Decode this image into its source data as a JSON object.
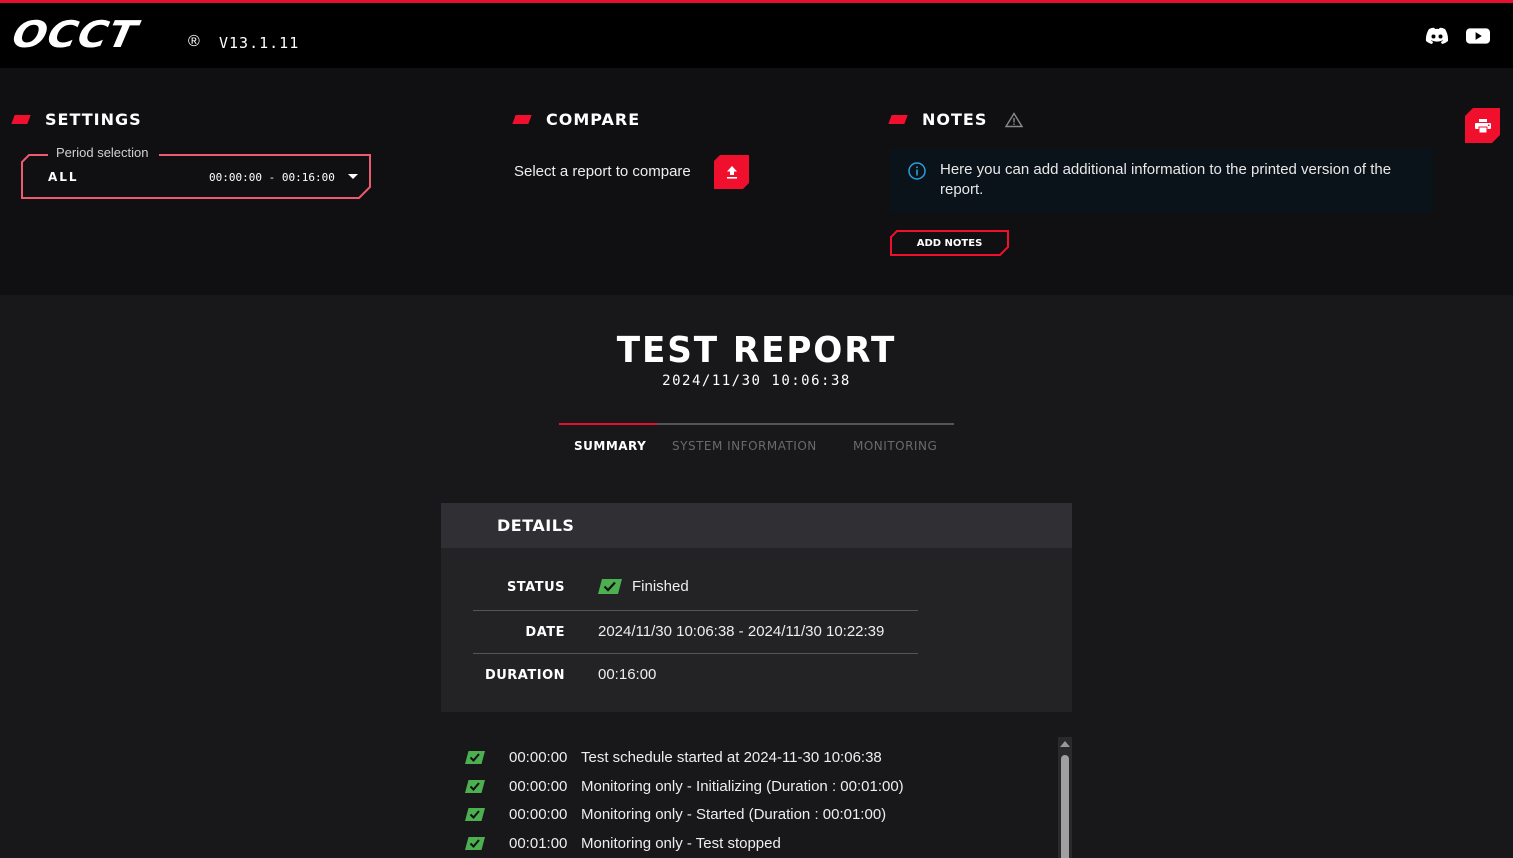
{
  "app": {
    "logo": "OCCT",
    "registered": "®",
    "version": "V13.1.11",
    "accent_color": "#f0102e"
  },
  "topbar_icons": [
    {
      "name": "discord-icon"
    },
    {
      "name": "youtube-icon"
    }
  ],
  "settings": {
    "title": "SETTINGS",
    "period_label": "Period selection",
    "period_value": "ALL",
    "period_range": "00:00:00 - 00:16:00"
  },
  "compare": {
    "title": "COMPARE",
    "prompt": "Select a report to compare"
  },
  "notes": {
    "title": "NOTES",
    "info_text": "Here you can add additional information to the printed version of the report.",
    "add_button": "ADD NOTES"
  },
  "report": {
    "title": "TEST REPORT",
    "date": "2024/11/30 10:06:38",
    "tabs": [
      {
        "label": "SUMMARY",
        "active": true
      },
      {
        "label": "SYSTEM INFORMATION",
        "active": false
      },
      {
        "label": "MONITORING",
        "active": false
      }
    ]
  },
  "details": {
    "title": "DETAILS",
    "rows": [
      {
        "label": "STATUS",
        "value": "Finished"
      },
      {
        "label": "DATE",
        "value": "2024/11/30 10:06:38 - 2024/11/30 10:22:39"
      },
      {
        "label": "DURATION",
        "value": "00:16:00"
      }
    ],
    "status_color": "#4caf50"
  },
  "log": [
    {
      "time": "00:00:00",
      "message": "Test schedule started at 2024-11-30 10:06:38"
    },
    {
      "time": "00:00:00",
      "message": "Monitoring only - Initializing (Duration : 00:01:00)"
    },
    {
      "time": "00:00:00",
      "message": "Monitoring only - Started (Duration : 00:01:00)"
    },
    {
      "time": "00:01:00",
      "message": "Monitoring only - Test stopped"
    }
  ]
}
